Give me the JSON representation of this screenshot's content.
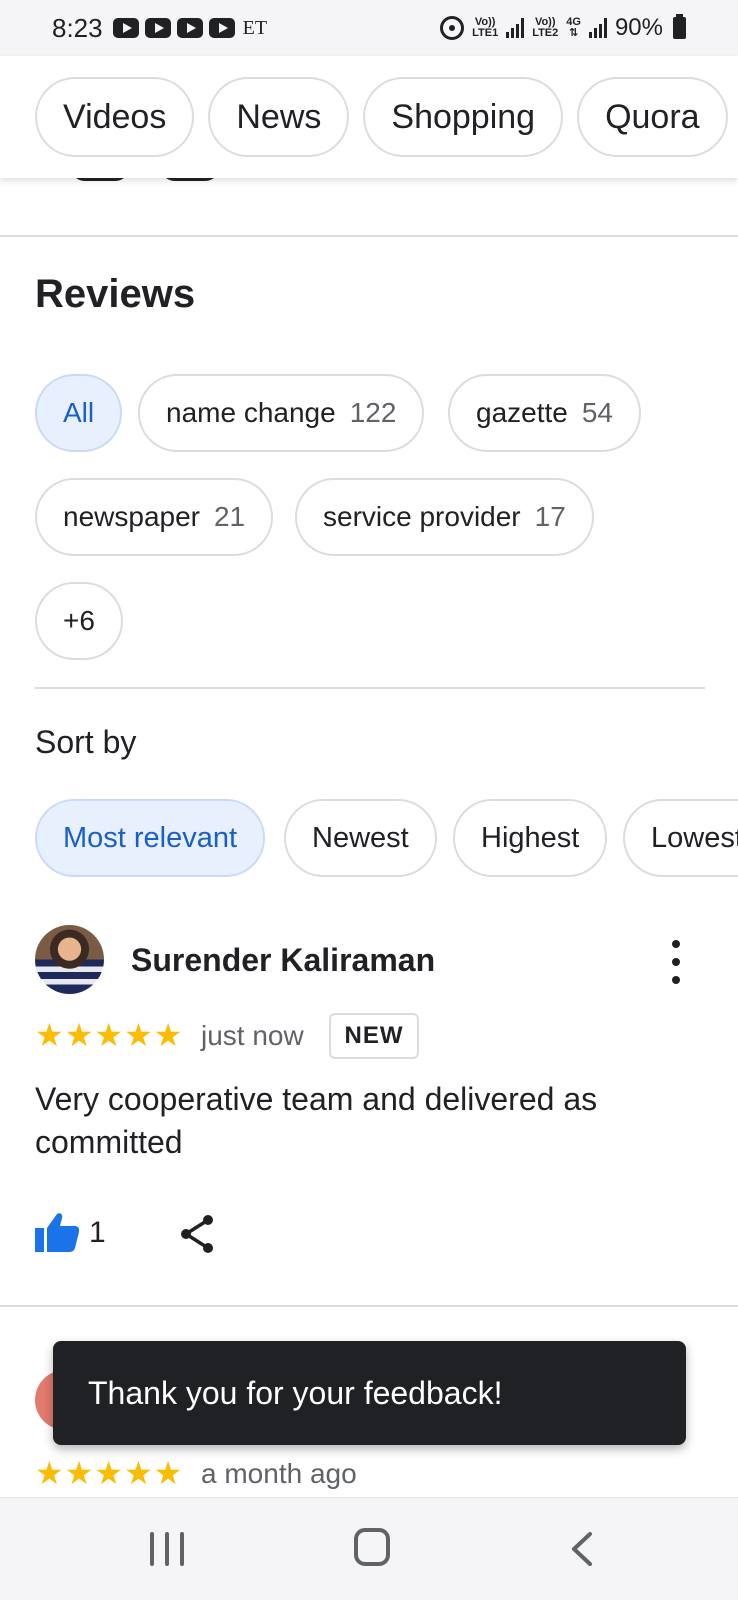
{
  "status_bar": {
    "time": "8:23",
    "carrier_text": "ET",
    "net1_top": "Vo))",
    "net1_bottom": "LTE1",
    "net2_top": "Vo))",
    "net2_bottom": "LTE2",
    "net2_type": "4G",
    "battery": "90%",
    "icons": [
      "youtube-icon",
      "youtube-icon",
      "youtube-icon",
      "youtube-icon",
      "hotspot-icon",
      "signal-icon",
      "signal-icon",
      "battery-icon"
    ]
  },
  "filter_tabs": [
    "Videos",
    "News",
    "Shopping",
    "Quora"
  ],
  "reviews": {
    "title": "Reviews",
    "topics": {
      "all": "All",
      "items": [
        {
          "label": "name change",
          "count": "122"
        },
        {
          "label": "gazette",
          "count": "54"
        },
        {
          "label": "newspaper",
          "count": "21"
        },
        {
          "label": "service provider",
          "count": "17"
        }
      ],
      "more": "+6"
    },
    "sort": {
      "label": "Sort by",
      "options": [
        "Most relevant",
        "Newest",
        "Highest",
        "Lowest"
      ],
      "selected": "Most relevant"
    },
    "items": [
      {
        "author": "Surender Kaliraman",
        "stars": "★★★★★",
        "rating": 5,
        "time": "just now",
        "badge": "NEW",
        "text": "Very cooperative team and delivered as committed",
        "likes": "1"
      },
      {
        "stars": "★★★★★",
        "rating": 5,
        "time": "a month ago"
      }
    ]
  },
  "toast": "Thank you for your feedback!",
  "colors": {
    "accent_blue": "#1a73e8",
    "chip_active_bg": "#e8f0fe",
    "star": "#fbbc04",
    "toast_bg": "#202124"
  }
}
